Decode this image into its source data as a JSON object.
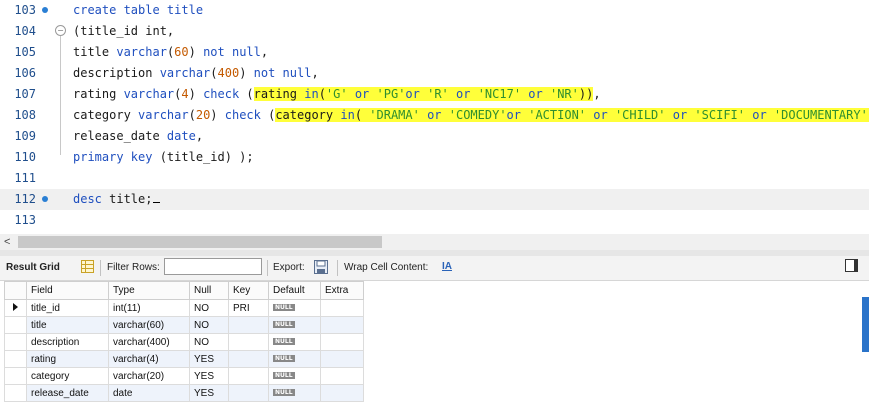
{
  "editor": {
    "lines": [
      {
        "n": "103"
      },
      {
        "n": "104"
      },
      {
        "n": "105"
      },
      {
        "n": "106"
      },
      {
        "n": "107"
      },
      {
        "n": "108"
      },
      {
        "n": "109"
      },
      {
        "n": "110"
      },
      {
        "n": "111"
      },
      {
        "n": "112"
      },
      {
        "n": "113"
      }
    ],
    "code": {
      "l103": "create table title",
      "l104": "(title_id int,",
      "l105_a": "title ",
      "l105_b": "varchar",
      "l105_c": "(",
      "l105_d": "60",
      "l105_e": ") ",
      "l105_f": "not null",
      "l105_g": ",",
      "l106_a": "description ",
      "l106_b": "varchar",
      "l106_c": "(",
      "l106_d": "400",
      "l106_e": ") ",
      "l106_f": "not null",
      "l106_g": ",",
      "l107_a": "rating ",
      "l107_b": "varchar",
      "l107_c": "(",
      "l107_d": "4",
      "l107_e": ") ",
      "l107_f": "check",
      "l107_g": " (",
      "l107_h1": "rating ",
      "l107_h2": "in",
      "l107_h3": "(",
      "l107_h4": "'G'",
      "l107_h5": " or ",
      "l107_h6": "'PG'",
      "l107_h7": "or ",
      "l107_h8": "'R'",
      "l107_h9": " or ",
      "l107_h10": "'NC17'",
      "l107_h11": " or ",
      "l107_h12": "'NR'",
      "l107_h13": "))",
      "l107_end": ",",
      "l108_a": "category ",
      "l108_b": "varchar",
      "l108_c": "(",
      "l108_d": "20",
      "l108_e": ") ",
      "l108_f": "check",
      "l108_g": " (",
      "l108_h1": "category ",
      "l108_h2": "in",
      "l108_h3": "( ",
      "l108_h4": "'DRAMA'",
      "l108_h5": " or ",
      "l108_h6": "'COMEDY'",
      "l108_h7": "or ",
      "l108_h8": "'ACTION'",
      "l108_h9": " or ",
      "l108_h10": "'CHILD'",
      "l108_h11": " or ",
      "l108_h12": "'SCIFI'",
      "l108_h13": " or ",
      "l108_h14": "'DOCUMENTARY'",
      "l108_h15": ")",
      "l108_end": "),",
      "l109_a": "release_date ",
      "l109_b": "date",
      "l109_c": ",",
      "l110_a": "primary key",
      "l110_b": " (title_id) );",
      "l112_a": "desc",
      "l112_b": " title;"
    }
  },
  "toolbar": {
    "result_tab": "Result Grid",
    "filter_label": "Filter Rows:",
    "filter_value": "",
    "export_label": "Export:",
    "wrap_label": "Wrap Cell Content:",
    "wrap_icon": "IA"
  },
  "grid": {
    "headers": [
      "Field",
      "Type",
      "Null",
      "Key",
      "Default",
      "Extra"
    ],
    "null_badge": "NULL",
    "rows": [
      {
        "field": "title_id",
        "type": "int(11)",
        "null": "NO",
        "key": "PRI",
        "extra": ""
      },
      {
        "field": "title",
        "type": "varchar(60)",
        "null": "NO",
        "key": "",
        "extra": ""
      },
      {
        "field": "description",
        "type": "varchar(400)",
        "null": "NO",
        "key": "",
        "extra": ""
      },
      {
        "field": "rating",
        "type": "varchar(4)",
        "null": "YES",
        "key": "",
        "extra": ""
      },
      {
        "field": "category",
        "type": "varchar(20)",
        "null": "YES",
        "key": "",
        "extra": ""
      },
      {
        "field": "release_date",
        "type": "date",
        "null": "YES",
        "key": "",
        "extra": ""
      }
    ]
  },
  "colors": {
    "keyword": "#1f4fbf",
    "number": "#c45a00",
    "string": "#2f8f2f",
    "highlight": "#ffff3a",
    "marker": "#2a7fd4"
  }
}
